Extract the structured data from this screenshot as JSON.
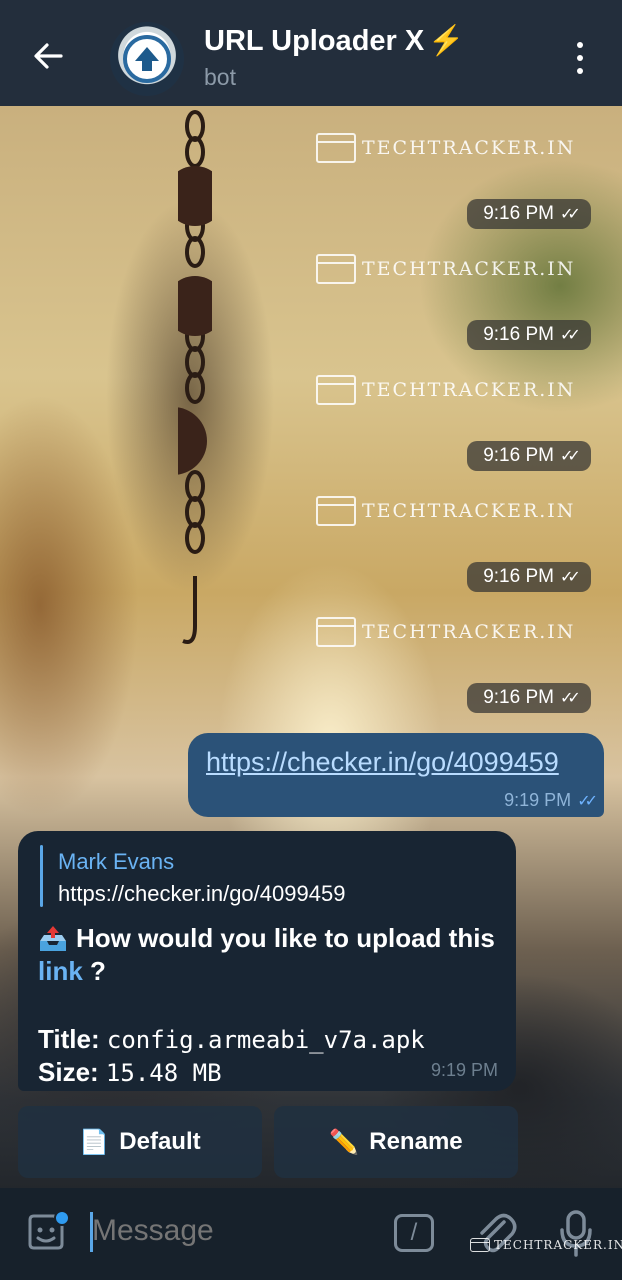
{
  "header": {
    "title": "URL Uploader X",
    "title_emoji": "⚡",
    "subtitle": "bot",
    "back_icon": "arrow-left-icon",
    "menu_icon": "more-vertical-icon"
  },
  "watermark": {
    "text": "TECHTRACKER.IN"
  },
  "sent_times": [
    "9:16 PM",
    "9:16 PM",
    "9:16 PM",
    "9:16 PM",
    "9:16 PM"
  ],
  "outgoing": {
    "link": "https://checker.in/go/4099459",
    "time": "9:19 PM",
    "status": "read"
  },
  "incoming": {
    "reply_name": "Mark Evans",
    "reply_text": "https://checker.in/go/4099459",
    "question_part1": "How would you like to upload this",
    "question_link": "link",
    "question_end": " ?",
    "title_label": "Title:",
    "title_value": "config.armeabi_v7a.apk",
    "size_label": "Size:",
    "size_value": "15.48 MB",
    "time": "9:19 PM"
  },
  "keyboard": [
    {
      "emoji": "📄",
      "label": "Default"
    },
    {
      "emoji": "✏️",
      "label": "Rename"
    }
  ],
  "input": {
    "placeholder": "Message"
  },
  "colors": {
    "header_bg": "#232e3c",
    "outgoing_bubble": "#2b5278",
    "incoming_bubble": "#182533",
    "link": "#6ab3f3",
    "accent": "#2f9bf0"
  }
}
